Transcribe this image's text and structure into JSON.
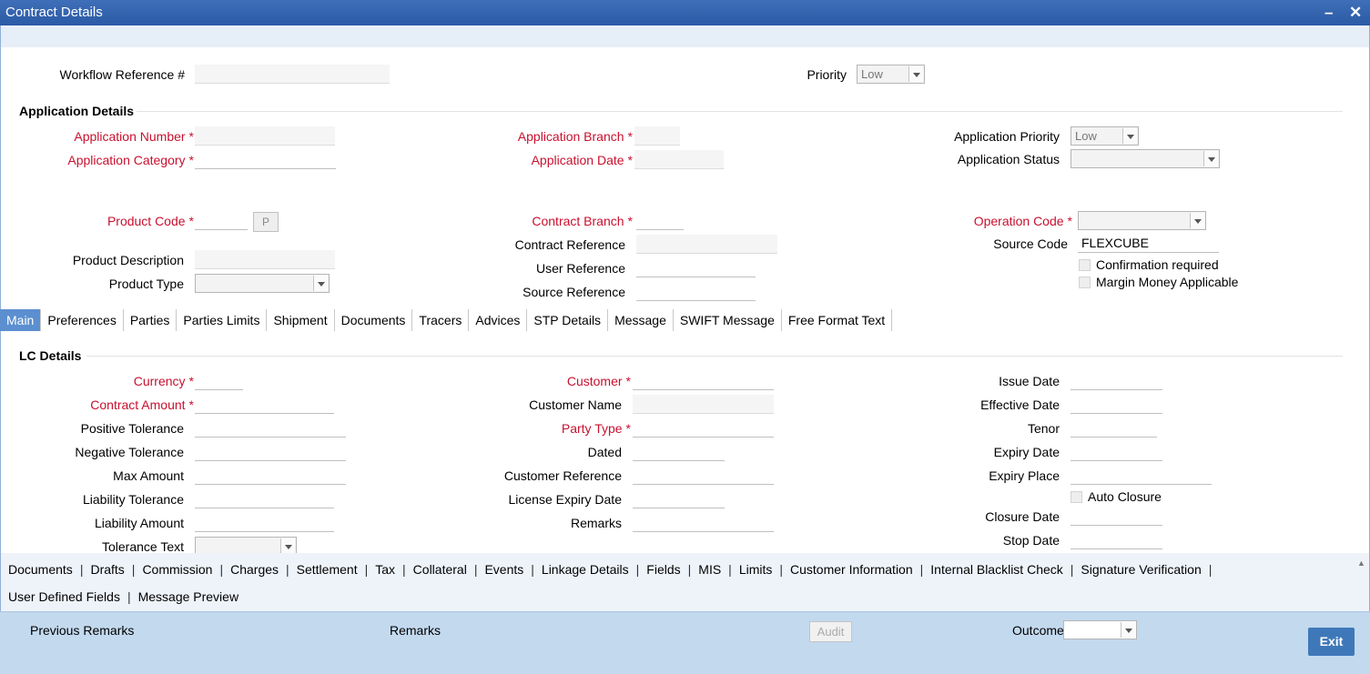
{
  "window": {
    "title": "Contract Details",
    "minimize_glyph": "–",
    "close_glyph": "✕"
  },
  "header": {
    "workflow_ref_label": "Workflow Reference #",
    "priority_label": "Priority",
    "priority_value": "Low"
  },
  "application": {
    "section_title": "Application Details",
    "number_label": "Application Number",
    "category_label": "Application Category",
    "branch_label": "Application Branch",
    "date_label": "Application Date",
    "priority_label": "Application Priority",
    "priority_value": "Low",
    "status_label": "Application Status",
    "status_value": ""
  },
  "product": {
    "code_label": "Product Code",
    "p_button": "P",
    "description_label": "Product Description",
    "type_label": "Product Type",
    "contract_branch_label": "Contract Branch",
    "contract_reference_label": "Contract Reference",
    "user_reference_label": "User Reference",
    "source_reference_label": "Source Reference",
    "operation_code_label": "Operation Code",
    "source_code_label": "Source Code",
    "source_code_value": "FLEXCUBE",
    "confirmation_label": "Confirmation required",
    "margin_label": "Margin Money Applicable"
  },
  "tabs": [
    "Main",
    "Preferences",
    "Parties",
    "Parties Limits",
    "Shipment",
    "Documents",
    "Tracers",
    "Advices",
    "STP Details",
    "Message",
    "SWIFT Message",
    "Free Format Text"
  ],
  "lc": {
    "section_title": "LC Details",
    "currency_label": "Currency",
    "contract_amount_label": "Contract Amount",
    "positive_tolerance_label": "Positive Tolerance",
    "negative_tolerance_label": "Negative Tolerance",
    "max_amount_label": "Max Amount",
    "liability_tolerance_label": "Liability Tolerance",
    "liability_amount_label": "Liability Amount",
    "tolerance_text_label": "Tolerance Text",
    "customer_label": "Customer",
    "customer_name_label": "Customer Name",
    "party_type_label": "Party Type",
    "dated_label": "Dated",
    "customer_reference_label": "Customer Reference",
    "license_expiry_label": "License Expiry Date",
    "remarks_label": "Remarks",
    "issue_date_label": "Issue Date",
    "effective_date_label": "Effective Date",
    "tenor_label": "Tenor",
    "expiry_date_label": "Expiry Date",
    "expiry_place_label": "Expiry Place",
    "auto_closure_label": "Auto Closure",
    "closure_date_label": "Closure Date",
    "stop_date_label": "Stop Date"
  },
  "subsystems": {
    "row1": [
      "Documents",
      "Drafts",
      "Commission",
      "Charges",
      "Settlement",
      "Tax",
      "Collateral",
      "Events",
      "Linkage Details",
      "Fields",
      "MIS",
      "Limits",
      "Customer Information",
      "Internal Blacklist Check",
      "Signature Verification"
    ],
    "row2": [
      "User Defined Fields",
      "Message Preview"
    ]
  },
  "footer": {
    "previous_remarks_label": "Previous Remarks",
    "remarks_label": "Remarks",
    "audit_button": "Audit",
    "outcome_label": "Outcome",
    "exit_button": "Exit"
  }
}
